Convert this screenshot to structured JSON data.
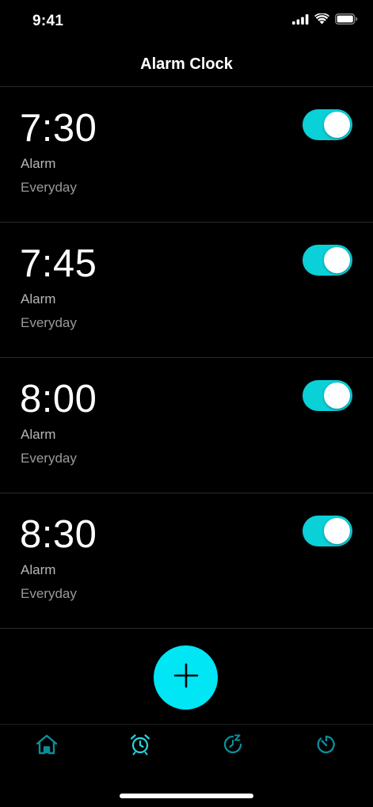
{
  "status_bar": {
    "time": "9:41"
  },
  "header": {
    "title": "Alarm Clock"
  },
  "alarms": [
    {
      "time": "7:30",
      "label": "Alarm",
      "repeat": "Everyday",
      "enabled": true
    },
    {
      "time": "7:45",
      "label": "Alarm",
      "repeat": "Everyday",
      "enabled": true
    },
    {
      "time": "8:00",
      "label": "Alarm",
      "repeat": "Everyday",
      "enabled": true
    },
    {
      "time": "8:30",
      "label": "Alarm",
      "repeat": "Everyday",
      "enabled": true
    }
  ],
  "add_button": {
    "icon": "plus-icon"
  },
  "tab_bar": {
    "items": [
      {
        "icon": "home-icon",
        "active": false
      },
      {
        "icon": "alarm-clock-icon",
        "active": true
      },
      {
        "icon": "sleep-timer-icon",
        "active": false
      },
      {
        "icon": "timer-icon",
        "active": false
      }
    ]
  },
  "colors": {
    "background": "#000000",
    "accent": "#00e6f5",
    "toggle_on": "#0ad0d8",
    "tab_inactive": "#0a8f9b",
    "tab_active": "#25d6e2",
    "secondary_text": "#b7b7b7"
  }
}
